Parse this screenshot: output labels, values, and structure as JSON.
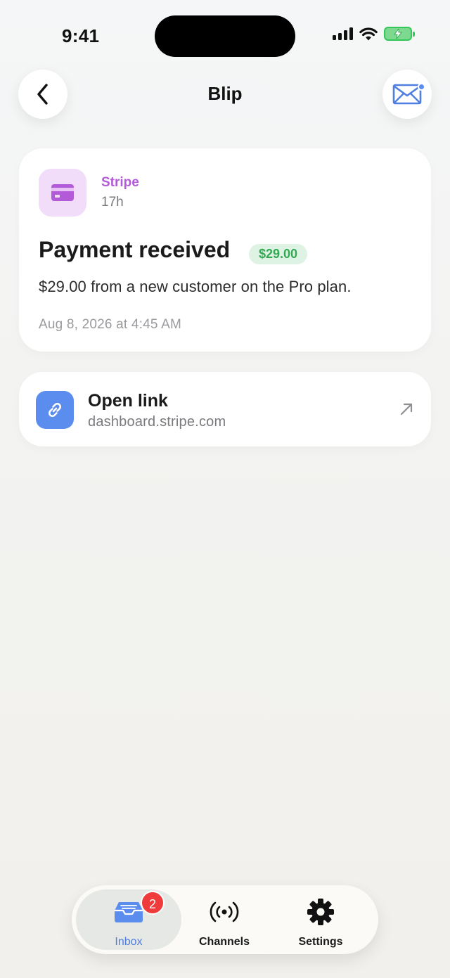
{
  "status_bar": {
    "time": "9:41"
  },
  "header": {
    "title": "Blip",
    "mail_has_unread": true
  },
  "notification": {
    "app_name": "Stripe",
    "app_color": "#b35ad9",
    "app_icon": "credit-card-icon",
    "age": "17h",
    "title": "Payment received",
    "amount_badge": "$29.00",
    "body": "$29.00 from a new customer on the Pro plan.",
    "date": "Aug 8, 2026 at 4:45 AM"
  },
  "link": {
    "label": "Open link",
    "url": "dashboard.stripe.com",
    "icon": "link-icon",
    "action_icon": "external-arrow-icon"
  },
  "tab_bar": {
    "tabs": [
      {
        "label": "Inbox",
        "icon": "inbox-tray-icon",
        "active": true,
        "badge": "2"
      },
      {
        "label": "Channels",
        "icon": "broadcast-icon",
        "active": false
      },
      {
        "label": "Settings",
        "icon": "gear-icon",
        "active": false
      }
    ]
  },
  "colors": {
    "accent_blue": "#5b8def",
    "success_green": "#34a853",
    "badge_red": "#ef3b3b"
  }
}
